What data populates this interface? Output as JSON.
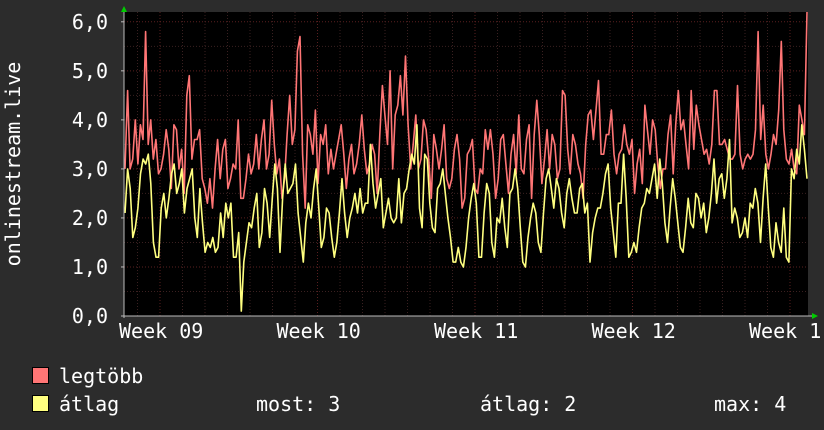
{
  "colors": {
    "background": "#2c2c2c",
    "plot_background": "#000000",
    "grid": "#5a1f1f",
    "axis": "#bbbbbb",
    "text": "#ffffff"
  },
  "chart_data": {
    "type": "area",
    "ylabel": "onlinestream.live",
    "ylim": [
      0,
      6.2
    ],
    "y_ticks": [
      "0,0",
      "1,0",
      "2,0",
      "3,0",
      "4,0",
      "5,0",
      "6,0"
    ],
    "x_ticks": [
      "Week 09",
      "Week 10",
      "Week 11",
      "Week 12",
      "Week 1"
    ],
    "grid": true,
    "series": [
      {
        "name": "legtöbb",
        "color": "#ff7575",
        "style": "line",
        "values": [
          3.0,
          4.6,
          3.0,
          3.2,
          4.0,
          3.1,
          3.9,
          3.6,
          5.8,
          3.5,
          4.0,
          3.2,
          3.6,
          2.9,
          3.0,
          3.3,
          3.8,
          3.4,
          2.6,
          3.9,
          3.8,
          3.0,
          3.4,
          2.5,
          4.5,
          4.9,
          3.2,
          3.6,
          3.6,
          3.8,
          2.8,
          2.6,
          2.3,
          2.8,
          2.2,
          3.0,
          3.6,
          2.8,
          3.4,
          3.6,
          2.6,
          2.8,
          3.1,
          3.0,
          4.0,
          2.4,
          2.4,
          2.8,
          3.3,
          2.9,
          3.1,
          3.7,
          3.0,
          3.6,
          4.0,
          3.0,
          3.3,
          4.4,
          3.5,
          2.9,
          3.2,
          2.4,
          2.8,
          3.7,
          4.5,
          3.5,
          3.8,
          5.4,
          5.7,
          3.3,
          2.2,
          3.9,
          3.7,
          3.3,
          4.2,
          2.7,
          3.7,
          3.5,
          3.9,
          2.9,
          3.4,
          3.0,
          3.3,
          3.6,
          3.9,
          3.3,
          2.6,
          3.2,
          3.5,
          2.9,
          3.1,
          3.5,
          4.1,
          3.4,
          2.9,
          3.1,
          3.5,
          3.3,
          2.5,
          3.7,
          4.7,
          4.1,
          3.5,
          5.0,
          3.0,
          4.1,
          4.3,
          4.9,
          4.1,
          5.3,
          3.9,
          3.0,
          3.5,
          4.1,
          3.0,
          3.2,
          4.0,
          3.8,
          3.2,
          2.4,
          3.7,
          3.4,
          3.0,
          3.4,
          3.9,
          2.8,
          2.6,
          2.8,
          3.4,
          3.7,
          3.2,
          2.2,
          2.4,
          3.3,
          3.4,
          3.6,
          2.6,
          2.5,
          3.0,
          2.9,
          3.8,
          3.4,
          3.8,
          3.3,
          2.4,
          2.8,
          3.6,
          3.7,
          3.1,
          2.5,
          3.3,
          3.7,
          2.9,
          4.1,
          3.0,
          2.9,
          3.6,
          3.9,
          2.4,
          3.7,
          4.4,
          3.7,
          2.7,
          3.2,
          3.8,
          3.0,
          3.7,
          3.5,
          2.8,
          3.0,
          4.6,
          4.5,
          3.4,
          2.9,
          3.7,
          3.5,
          3.1,
          2.9,
          2.4,
          3.5,
          4.1,
          4.2,
          3.6,
          4.2,
          4.8,
          3.3,
          3.3,
          3.7,
          3.7,
          4.2,
          3.3,
          2.9,
          3.3,
          3.4,
          3.9,
          3.5,
          3.3,
          3.6,
          2.5,
          3.1,
          3.4,
          2.7,
          4.3,
          3.8,
          3.3,
          4.0,
          3.8,
          3.1,
          2.6,
          3.0,
          3.0,
          3.7,
          4.1,
          2.9,
          3.9,
          4.6,
          3.8,
          4.0,
          3.5,
          3.0,
          4.6,
          3.4,
          4.3,
          3.9,
          3.6,
          3.3,
          3.4,
          3.1,
          3.5,
          4.6,
          4.6,
          3.5,
          3.5,
          3.6,
          3.4,
          3.2,
          3.2,
          3.3,
          4.7,
          3.3,
          3.0,
          3.2,
          3.3,
          3.2,
          3.3,
          3.8,
          5.8,
          3.6,
          4.3,
          3.3,
          3.0,
          3.3,
          3.7,
          3.5,
          4.2,
          5.6,
          3.8,
          3.2,
          3.1,
          3.4,
          3.0,
          2.9,
          4.3,
          4.0,
          3.7,
          6.2
        ]
      },
      {
        "name": "átlag",
        "color": "#ffff80",
        "style": "line",
        "values": [
          2.1,
          3.0,
          2.6,
          1.6,
          1.8,
          2.2,
          2.9,
          3.2,
          3.1,
          3.3,
          2.7,
          1.5,
          1.2,
          1.2,
          2.2,
          2.5,
          2.0,
          2.4,
          2.9,
          3.1,
          2.5,
          2.7,
          3.0,
          2.1,
          2.6,
          2.8,
          3.0,
          2.0,
          1.6,
          2.6,
          1.9,
          1.3,
          1.5,
          1.4,
          1.6,
          1.3,
          1.4,
          2.1,
          1.6,
          2.3,
          2.0,
          2.3,
          1.2,
          1.2,
          1.7,
          0.1,
          1.1,
          1.5,
          1.9,
          1.8,
          2.2,
          2.5,
          1.4,
          1.7,
          2.6,
          2.3,
          1.6,
          2.4,
          3.1,
          2.6,
          1.3,
          2.4,
          3.1,
          2.5,
          2.6,
          2.7,
          3.1,
          2.1,
          1.6,
          1.1,
          1.9,
          2.3,
          2.0,
          2.6,
          3.0,
          2.2,
          1.4,
          1.6,
          2.2,
          2.1,
          1.6,
          1.2,
          1.5,
          2.1,
          2.8,
          2.1,
          1.6,
          2.0,
          2.2,
          2.5,
          2.1,
          2.6,
          2.1,
          2.3,
          2.3,
          3.5,
          2.7,
          2.2,
          2.5,
          2.8,
          1.8,
          2.1,
          2.4,
          2.0,
          1.9,
          2.0,
          2.8,
          1.9,
          2.5,
          2.6,
          3.0,
          3.3,
          3.1,
          3.9,
          2.2,
          1.8,
          3.3,
          3.2,
          2.3,
          1.8,
          1.7,
          2.6,
          2.7,
          3.0,
          2.5,
          2.0,
          1.6,
          1.1,
          1.1,
          1.4,
          1.1,
          1.0,
          1.4,
          2.0,
          2.4,
          2.7,
          2.3,
          1.2,
          1.2,
          2.1,
          2.7,
          2.5,
          1.5,
          1.2,
          2.0,
          1.9,
          2.4,
          1.8,
          1.4,
          2.5,
          2.6,
          3.0,
          2.6,
          1.8,
          1.1,
          1.0,
          1.6,
          2.0,
          2.3,
          2.1,
          1.5,
          1.3,
          2.1,
          2.8,
          3.0,
          2.6,
          2.2,
          2.8,
          2.6,
          2.1,
          1.8,
          2.5,
          2.8,
          2.4,
          2.1,
          2.1,
          2.6,
          2.7,
          2.1,
          2.3,
          1.1,
          1.7,
          2.0,
          2.2,
          2.2,
          2.5,
          2.9,
          3.1,
          2.2,
          1.7,
          1.2,
          2.3,
          2.3,
          3.3,
          2.4,
          1.2,
          1.3,
          1.5,
          1.3,
          1.8,
          2.2,
          2.3,
          2.6,
          2.5,
          2.8,
          3.1,
          2.4,
          3.2,
          2.7,
          1.9,
          1.5,
          2.2,
          2.8,
          2.4,
          1.9,
          1.4,
          1.3,
          1.8,
          2.4,
          1.9,
          1.8,
          2.5,
          2.4,
          2.0,
          2.3,
          1.7,
          2.0,
          2.5,
          3.2,
          2.3,
          2.8,
          2.9,
          2.4,
          2.8,
          3.6,
          1.9,
          2.2,
          2.0,
          1.6,
          1.7,
          2.0,
          1.6,
          2.3,
          2.2,
          2.6,
          2.3,
          1.5,
          2.4,
          3.1,
          2.2,
          1.4,
          1.2,
          1.9,
          1.5,
          1.3,
          2.2,
          1.2,
          1.1,
          3.0,
          2.8,
          3.4,
          3.1,
          3.9,
          3.4,
          2.8
        ]
      }
    ]
  },
  "legend": {
    "max_label": "legtöbb",
    "avg_label": "átlag",
    "stat_now": "most: 3",
    "stat_avg": "átlag: 2",
    "stat_max": "max: 4"
  }
}
